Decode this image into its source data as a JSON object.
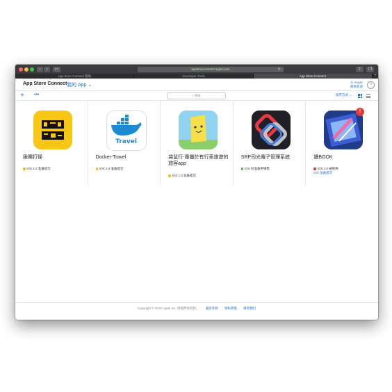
{
  "browser": {
    "url": "appstoreconnect.apple.com",
    "tabs": [
      "App Store Connect 帮助",
      "Developer Tools",
      "App Store Connect"
    ],
    "active_tab": 2
  },
  "header": {
    "brand": "App Store Connect",
    "section": "我的 App",
    "user_name": "Li Xuyan",
    "user_org": "网易有道"
  },
  "toolbar": {
    "search_placeholder": "搜索",
    "sort_label": "排序方式"
  },
  "apps": [
    {
      "name": "揪團打怪",
      "platform": "iOS",
      "version": "1.2",
      "status": "iOS 1.2 准备提交",
      "status_color": "#f2c200",
      "icon": "gather-fight-icon"
    },
    {
      "name": "Docker-Travel",
      "platform": "iOS",
      "version": "1.0",
      "status": "iOS 1.0 准备提交",
      "status_color": "#f2c200",
      "icon": "docker-whale-icon"
    },
    {
      "name": "袋鼠行-專屬於有行車旅遊的旅客app",
      "platform": "iOS",
      "version": "1.0",
      "status": "iOS 1.0 准备提交",
      "status_color": "#f2c200",
      "icon": "yellow-character-icon"
    },
    {
      "name": "SRP司光電子管理系統",
      "platform": "iOS",
      "version": "",
      "status": "iOS 已准备供销售",
      "status_color": "#34c84a",
      "icon": "srp-chain-icon"
    },
    {
      "name": "讀BOOK",
      "platform": "iOS",
      "version": "1.0",
      "status": "iOS 1.0 被拒绝",
      "status_color": "#e53935",
      "status2": "iOS 准备提交",
      "badge": "!",
      "icon": "ebook-icon"
    }
  ],
  "footer": {
    "copyright": "Copyright © 2018 Apple Inc. 保留所有权利。",
    "links": [
      "服务条款",
      "隐私政策",
      "联系我们"
    ]
  }
}
